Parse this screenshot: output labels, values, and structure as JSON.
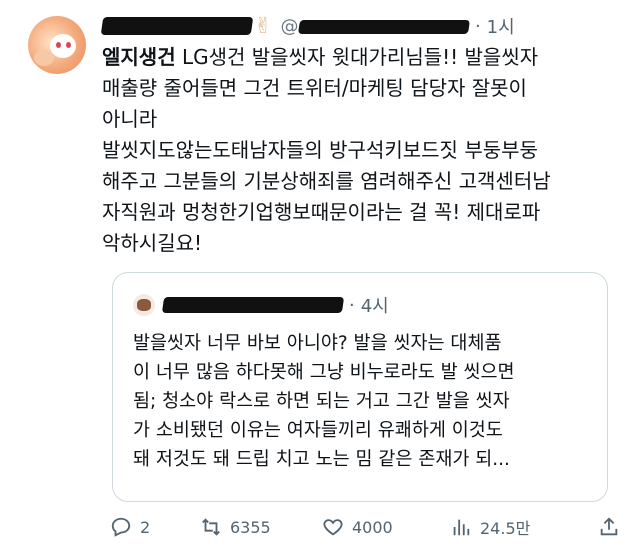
{
  "tweet": {
    "handle_partial": "@...",
    "separator": "·",
    "time": "1시",
    "text_bold": "엘지생건",
    "text_rest": " LG생건 발을씻자 윗대가리님들!! 발을씻자\n매출량 줄어들면 그건 트위터/마케팅 담당자 잘못이\n아니라\n발씻지도않는도태남자들의 방구석키보드짓 부둥부둥\n해주고 그분들의 기분상해죄를 염려해주신 고객센터남\n자직원과 멍청한기업행보때문이라는 걸 꼭! 제대로파\n악하시길요!"
  },
  "quote": {
    "separator": "·",
    "time": "4시",
    "text": "발을씻자 너무 바보 아니야? 발을 씻자는 대체품\n이 너무 많음 하다못해 그냥 비누로라도 발 씻으면\n됨; 청소야 락스로 하면 되는 거고 그간 발을 씻자\n가 소비됐던 이유는 여자들끼리 유쾌하게 이것도\n돼 저것도 돼 드립 치고 노는 밈 같은 존재가 되..."
  },
  "actions": {
    "replies": "2",
    "reposts": "6355",
    "likes": "4000",
    "views": "24.5만"
  },
  "icons": {
    "reply": "speech-bubble-icon",
    "repost": "repost-icon",
    "like": "heart-icon",
    "views": "bar-chart-icon",
    "bookmark": "bookmark-icon",
    "share": "share-icon"
  },
  "colors": {
    "text": "#0f1419",
    "muted": "#536471",
    "border": "#cfd9de"
  }
}
